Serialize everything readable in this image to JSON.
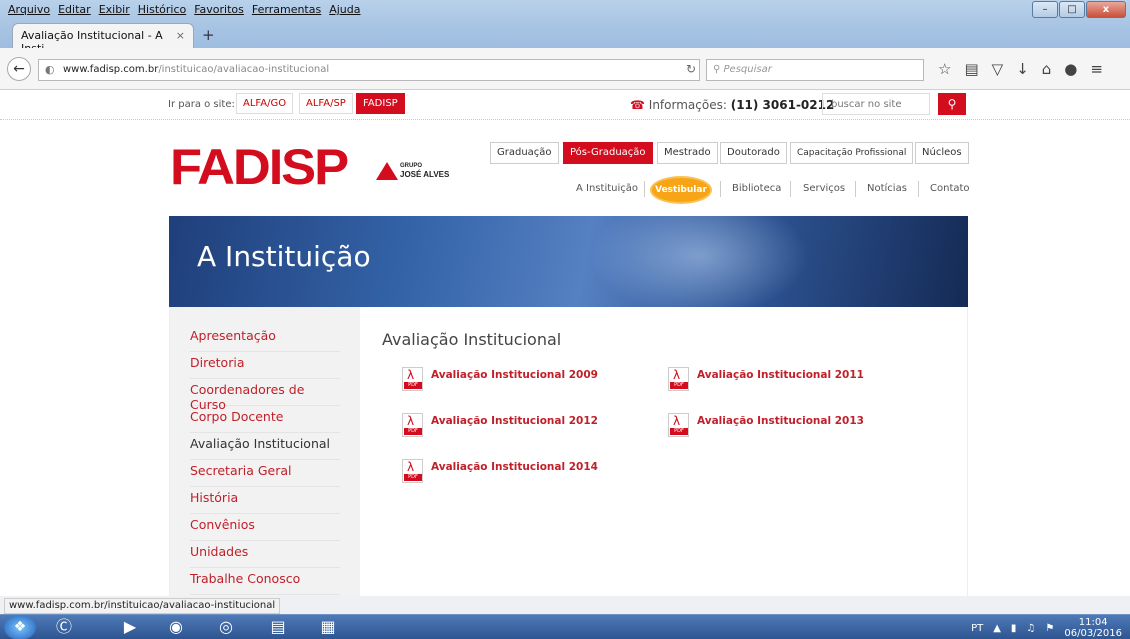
{
  "browser": {
    "menu": [
      "Arquivo",
      "Editar",
      "Exibir",
      "Histórico",
      "Favoritos",
      "Ferramentas",
      "Ajuda"
    ],
    "tab_title": "Avaliação Institucional - A Insti...",
    "tab_close": "×",
    "new_tab": "+",
    "url_domain": "www.fadisp.com.br",
    "url_path": "/instituicao/avaliacao-institucional",
    "search_placeholder": "Pesquisar",
    "window_controls": [
      "–",
      "□",
      "x"
    ],
    "status_url": "www.fadisp.com.br/instituicao/avaliacao-institucional"
  },
  "topbar": {
    "goto_label": "Ir para o site:",
    "sites": [
      "ALFA/GO",
      "ALFA/SP",
      "FADISP"
    ],
    "active_site": "FADISP",
    "info_label": "Informações:",
    "phone": "(11) 3061-0212",
    "search_placeholder": "buscar no site",
    "search_icon": "search-icon"
  },
  "header": {
    "logo": "FADISP",
    "group_line1": "GRUPO",
    "group_line2": "JOSÉ ALVES",
    "main_nav": [
      "Graduação",
      "Pós-Graduação",
      "Mestrado",
      "Doutorado",
      "Capacitação Profissional",
      "Núcleos"
    ],
    "active_main": "Pós-Graduação",
    "sub_nav": [
      "A Instituição",
      "Vestibular",
      "Biblioteca",
      "Serviços",
      "Notícias",
      "Contato"
    ],
    "highlight_color": "#d30c1e",
    "vestibular_color": "#f7a516"
  },
  "banner": {
    "title": "A Instituição"
  },
  "sidebar": {
    "items": [
      "Apresentação",
      "Diretoria",
      "Coordenadores de Curso",
      "Corpo Docente",
      "Avaliação Institucional",
      "Secretaria Geral",
      "História",
      "Convênios",
      "Unidades",
      "Trabalhe Conosco"
    ],
    "current": "Avaliação Institucional"
  },
  "main": {
    "title": "Avaliação Institucional",
    "pdf_label": "PDF",
    "documents": [
      "Avaliação Institucional 2009",
      "Avaliação Institucional 2011",
      "Avaliação Institucional 2012",
      "Avaliação Institucional 2013",
      "Avaliação Institucional 2014"
    ]
  },
  "taskbar": {
    "lang": "PT",
    "time": "11:04",
    "date": "06/03/2016"
  }
}
